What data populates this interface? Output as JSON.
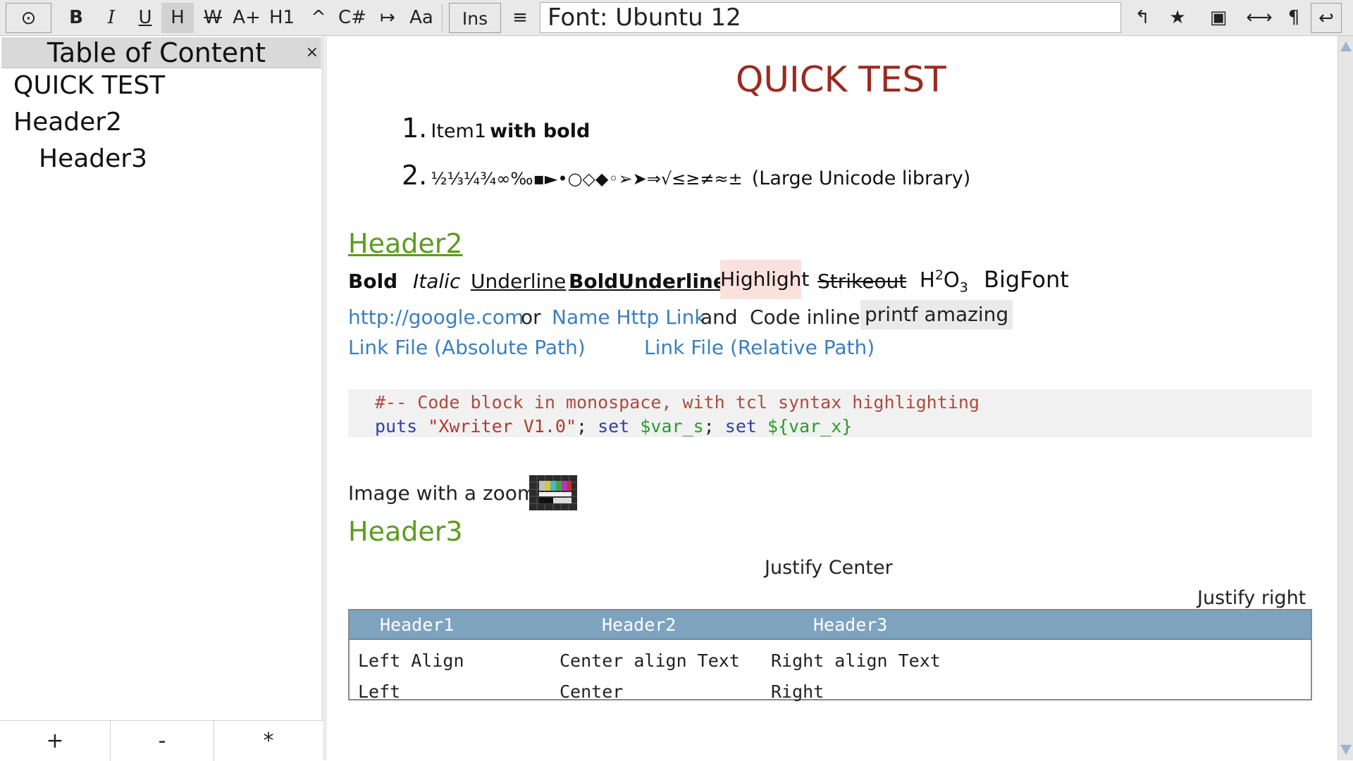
{
  "toolbar": {
    "buttons": {
      "target": "⊙",
      "bold": "B",
      "italic": "I",
      "underline": "U",
      "heading": "H",
      "strike": "W",
      "bigger": "A+",
      "h1": "H1",
      "superscript": "^",
      "code": "C#",
      "indent": "↦",
      "case": "Aa",
      "insert": "Ins",
      "menu": "≡",
      "undo": "↰",
      "star": "★",
      "box": "▣",
      "width": "⟷",
      "pilcrow": "¶",
      "enter": "↩"
    },
    "font_field": "Font: Ubuntu 12"
  },
  "sidebar": {
    "title": "Table of Content",
    "close": "×",
    "items": [
      "QUICK TEST",
      "Header2",
      "Header3"
    ],
    "footer": {
      "add": "+",
      "remove": "-",
      "all": "*"
    }
  },
  "document": {
    "title": "QUICK TEST",
    "list": [
      {
        "num": "1.",
        "text": "Item1",
        "bold": "with bold"
      },
      {
        "num": "2.",
        "text": "½⅓¼¾∞‰▪►•○◇◆◦➢➤⇒√≤≥≠≈±",
        "note": "(Large Unicode library)"
      }
    ],
    "header2": "Header2",
    "formats": {
      "bold": "Bold",
      "italic": "Italic",
      "underline": "Underline",
      "bold_underline": "BoldUnderline",
      "highlight": "Highlight",
      "strikeout": "Strikeout",
      "chem_h": "H",
      "chem_sup": "2",
      "chem_o": "O",
      "chem_sub": "3",
      "bigfont": "BigFont"
    },
    "links": {
      "url": "http://google.com",
      "or": "or",
      "named": "Name Http Link",
      "and": "and",
      "code_label": "Code inline:",
      "code_inline": "printf amazing",
      "file_abs": "Link File (Absolute Path)",
      "file_rel": "Link File (Relative Path)"
    },
    "code": {
      "comment": "#-- Code block in monospace, with tcl syntax highlighting",
      "kw_puts": "puts",
      "str": "\"Xwriter V1.0\"",
      "semi1": ";",
      "kw_set1": "set",
      "var1": "$var_s",
      "semi2": ";",
      "kw_set2": "set",
      "var2": "${var_x}"
    },
    "image_label": "Image with a zoom:",
    "header3": "Header3",
    "justify_center": "Justify Center",
    "justify_right": "Justify right",
    "table": {
      "headers": [
        "Header1",
        "Header2",
        "Header3"
      ],
      "rows": [
        [
          "Left Align",
          "Center align Text",
          "Right align Text"
        ],
        [
          "Left",
          "Center",
          "Right"
        ]
      ]
    }
  },
  "colors": {
    "title_red": "#9a2a22",
    "header_green": "#5b9c1e",
    "link_blue": "#3b7fc0",
    "highlight_bg": "#fbe1de",
    "table_header_bg": "#7ea3bf"
  }
}
